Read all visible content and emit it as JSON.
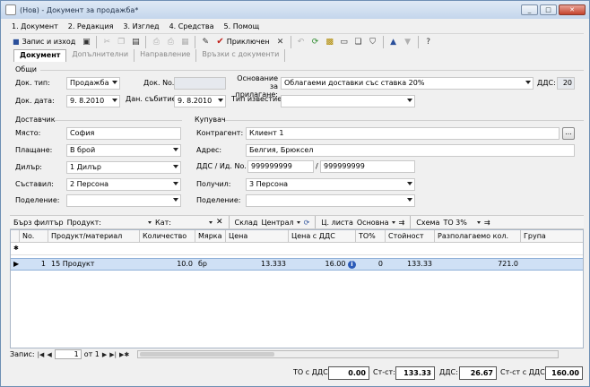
{
  "window": {
    "title": "(Нов) - Документ за продажба*",
    "btn_min": "_",
    "btn_max": "□",
    "btn_close": "✕"
  },
  "menu": [
    "1. Документ",
    "2. Редакция",
    "3. Изглед",
    "4. Средства",
    "5. Помощ"
  ],
  "toolbar": {
    "save_exit": "Запис и изход",
    "post": "Приключен"
  },
  "tabs": [
    "Документ",
    "Допълнителни",
    "Направление",
    "Връзки с документи"
  ],
  "general": {
    "heading": "Общи",
    "doc_type_label": "Док. тип:",
    "doc_type_value": "Продажба",
    "doc_no_label": "Док. No.",
    "doc_no_value": "",
    "basis_label": "Основание за прилагане:",
    "basis_value": "Облагаеми доставки със ставка 20%",
    "vat_label": "ДДС:",
    "vat_value": "20",
    "doc_date_label": "Док. дата:",
    "doc_date_value": "9. 8.2010",
    "event_date_label": "Дан. събитие:",
    "event_date_value": "9. 8.2010",
    "notice_type_label": "Тип известие:",
    "notice_type_value": ""
  },
  "supplier": {
    "heading": "Доставчик",
    "place_label": "Място:",
    "place_value": "София",
    "payment_label": "Плащане:",
    "payment_value": "В брой",
    "dealer_label": "Дилър:",
    "dealer_value": "1 Дилър",
    "author_label": "Съставил:",
    "author_value": "2 Персона",
    "division_label": "Поделение:",
    "division_value": ""
  },
  "buyer": {
    "heading": "Купувач",
    "partner_label": "Контрагент:",
    "partner_value": "Клиент 1",
    "browse": "...",
    "address_label": "Адрес:",
    "address_value": "Белгия, Брюксел",
    "vat_id_label": "ДДС / Ид. No.",
    "vat_value": "999999999",
    "slash": "/",
    "id_value": "999999999",
    "received_label": "Получил:",
    "received_value": "3 Персона",
    "division_label": "Поделение:",
    "division_value": ""
  },
  "filterbar": {
    "quick_filter": "Бърз филтър",
    "product_label": "Продукт:",
    "cat_label": "Кат:",
    "warehouse_label": "Склад",
    "warehouse_value": "Централ",
    "pricelist_label": "Ц. листа",
    "pricelist_value": "Основна",
    "scheme_label": "Схема",
    "scheme_value": "ТО 3%"
  },
  "grid": {
    "columns": [
      "No.",
      "Продукт/материал",
      "Количество",
      "Мярка",
      "Цена",
      "Цена с ДДС",
      "ТО%",
      "Стойност",
      "Разполагаемо кол.",
      "Група"
    ],
    "new_row_marker": "✱",
    "rows": [
      {
        "no": "1",
        "product": "15 Продукт",
        "qty": "10.0",
        "unit": "бр",
        "price": "13.333",
        "price_vat": "16.00",
        "to_pct": "0",
        "value": "133.33",
        "available": "721.0",
        "group": ""
      }
    ]
  },
  "navigator": {
    "label": "Запис:",
    "current": "1",
    "of": "от 1"
  },
  "totals": {
    "to_vat_label": "ТО с ДДС:",
    "to_vat_value": "0.00",
    "value_label": "Ст-ст:",
    "value_value": "133.33",
    "vat_label": "ДДС:",
    "vat_value": "26.67",
    "total_label": "Ст-ст с ДДС:",
    "total_value": "160.00"
  }
}
